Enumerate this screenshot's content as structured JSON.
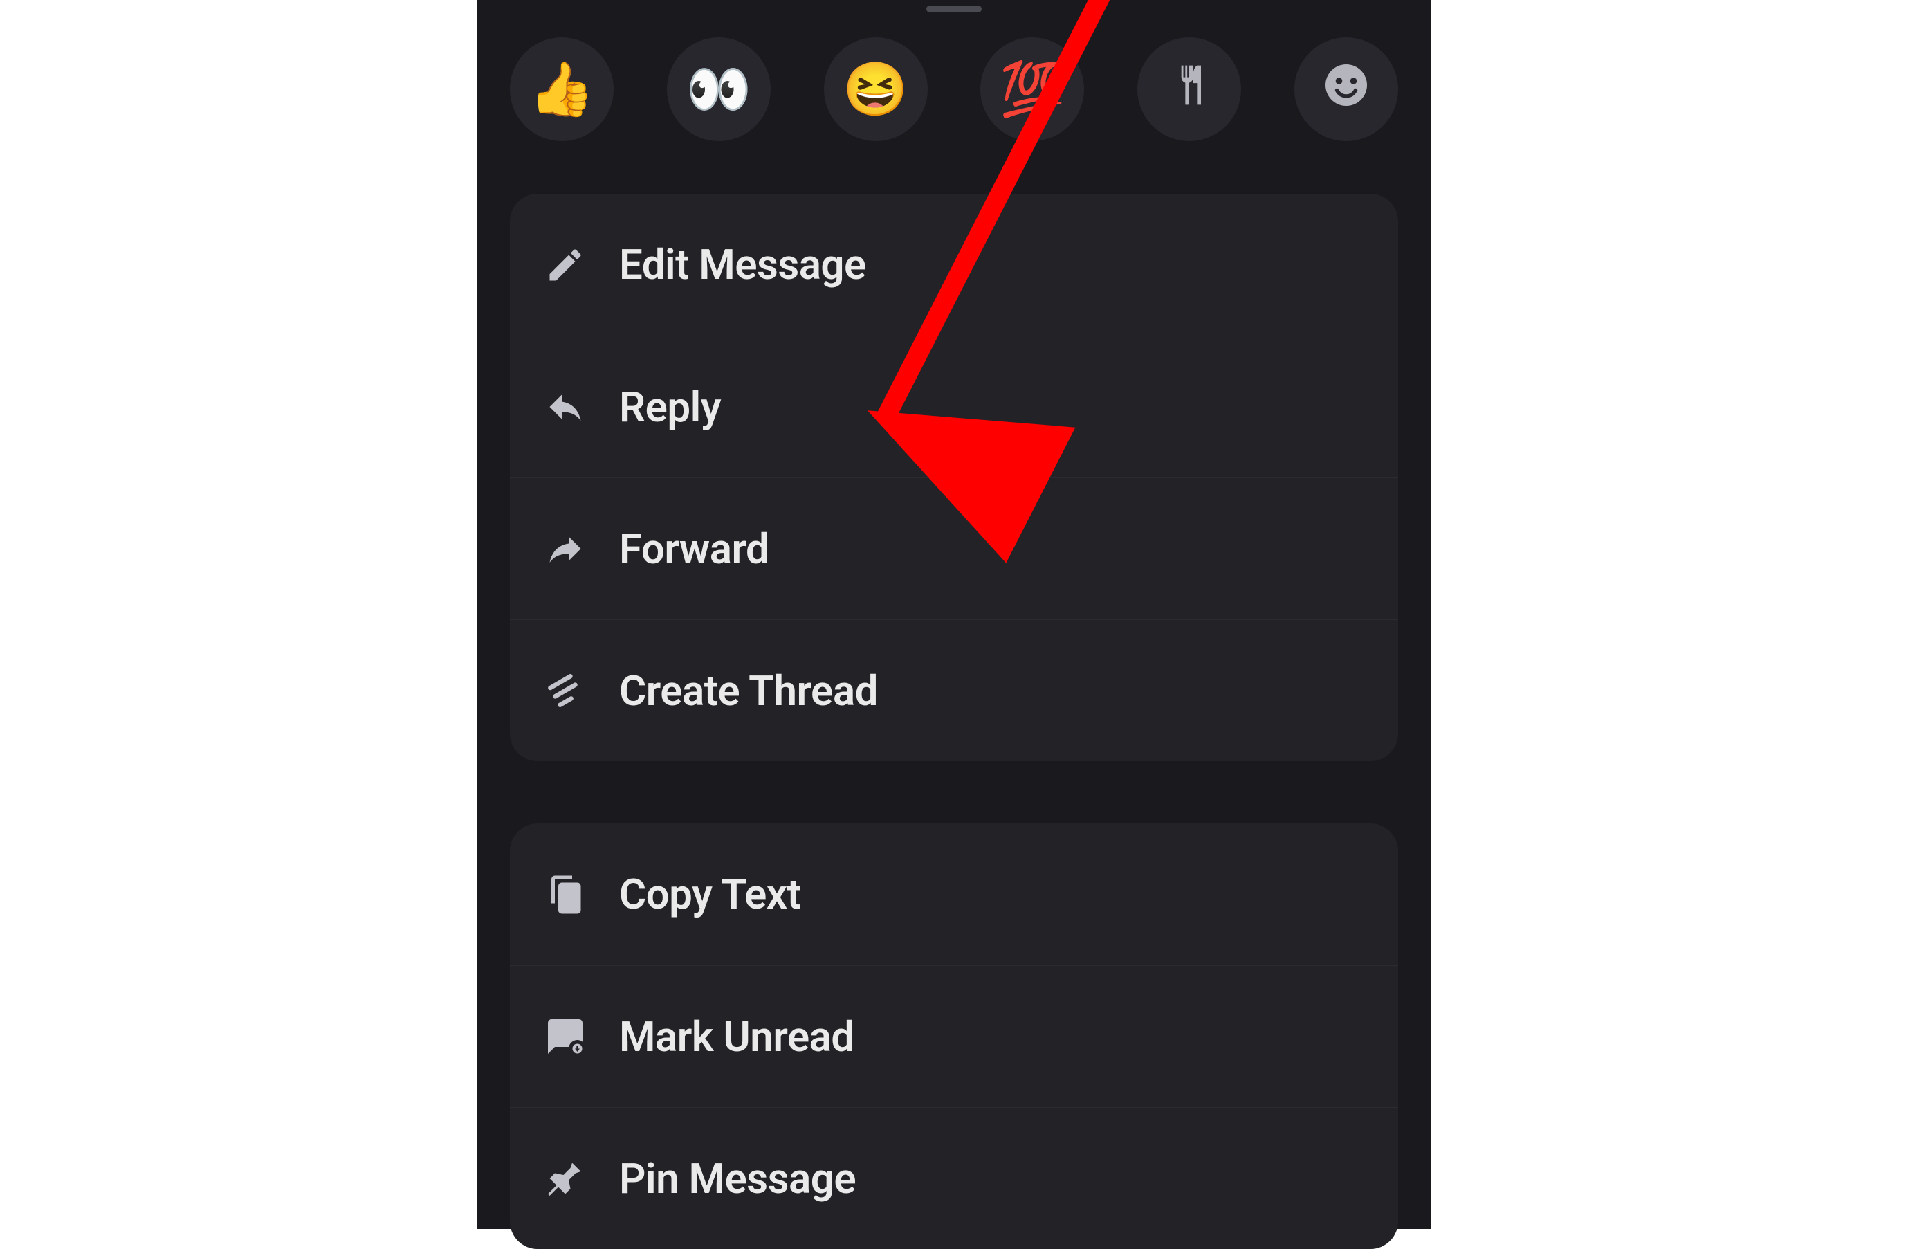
{
  "reactions": [
    {
      "name": "thumbs-up-reaction",
      "emoji": "👍"
    },
    {
      "name": "eyes-reaction",
      "emoji": "👀"
    },
    {
      "name": "laugh-reaction",
      "emoji": "😆"
    },
    {
      "name": "hundred-reaction",
      "emoji": "💯"
    },
    {
      "name": "fork-knife-reaction",
      "emoji": "🍴"
    },
    {
      "name": "add-reaction",
      "emoji": ""
    }
  ],
  "group1": {
    "edit_label": "Edit Message",
    "reply_label": "Reply",
    "forward_label": "Forward",
    "thread_label": "Create Thread"
  },
  "group2": {
    "copy_label": "Copy Text",
    "unread_label": "Mark Unread",
    "pin_label": "Pin Message"
  },
  "annotation": {
    "color": "#ff0000",
    "target": "forward"
  }
}
